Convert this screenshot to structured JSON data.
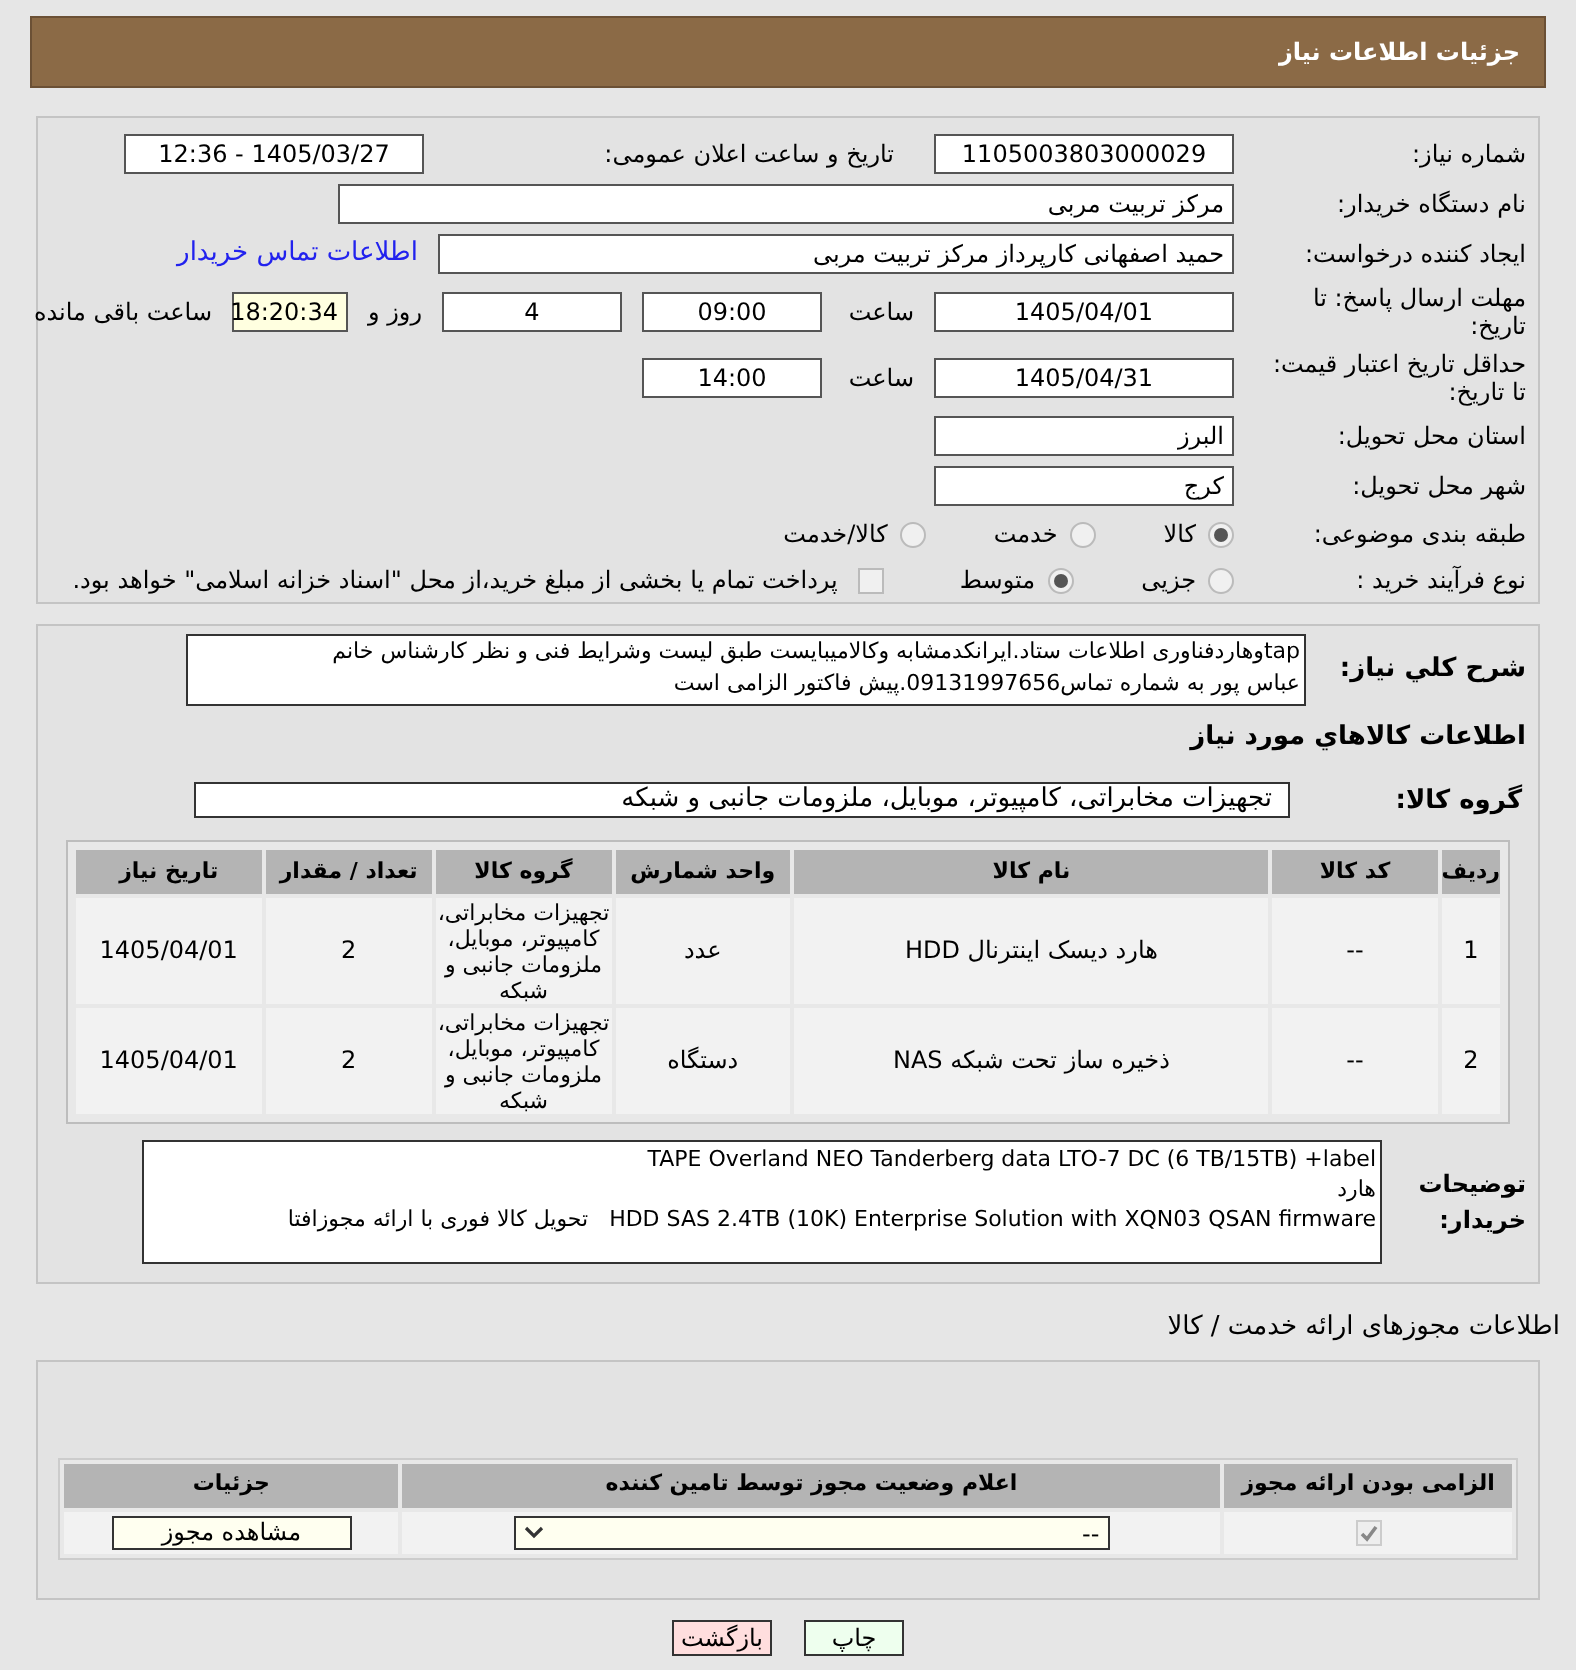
{
  "header": {
    "title": "جزئیات اطلاعات نیاز"
  },
  "need_number": {
    "label": "شماره نیاز:",
    "value": "1105003803000029"
  },
  "announce": {
    "label": "تاریخ و ساعت اعلان عمومی:",
    "value": "1405/03/27 - 12:36"
  },
  "buyer_org": {
    "label": "نام دستگاه خریدار:",
    "value": "مرکز تربیت مربی"
  },
  "creator": {
    "label": "ایجاد کننده درخواست:",
    "value": "حمید اصفهانی کارپرداز مرکز تربیت مربی",
    "link": "اطلاعات تماس خریدار"
  },
  "deadline": {
    "label": "مهلت ارسال پاسخ: تا تاریخ:",
    "date": "1405/04/01",
    "time_label": "ساعت",
    "time": "09:00",
    "days": "4",
    "days_label": "روز و",
    "remaining": "18:20:34",
    "remaining_label": "ساعت باقی مانده"
  },
  "validity": {
    "label": "حداقل تاریخ اعتبار قیمت: تا تاریخ:",
    "date": "1405/04/31",
    "time_label": "ساعت",
    "time": "14:00"
  },
  "province": {
    "label": "استان محل تحویل:",
    "value": "البرز"
  },
  "city": {
    "label": "شهر محل تحویل:",
    "value": "کرج"
  },
  "category": {
    "label": "طبقه بندی موضوعی:",
    "options": [
      {
        "label": "کالا",
        "selected": true
      },
      {
        "label": "خدمت",
        "selected": false
      },
      {
        "label": "کالا/خدمت",
        "selected": false
      }
    ]
  },
  "process": {
    "label": "نوع فرآیند خرید :",
    "options": [
      {
        "label": "جزیی",
        "selected": false
      },
      {
        "label": "متوسط",
        "selected": true
      }
    ],
    "payment": {
      "label": "پرداخت تمام یا بخشی از مبلغ خرید،از محل \"اسناد خزانه اسلامی\" خواهد بود.",
      "checked": false
    }
  },
  "description": {
    "label": "شرح کلي نیاز:",
    "lines": [
      "tapوهاردفناوری اطلاعات ستاد.ایرانکدمشابه وکالامیبایست طبق لیست وشرایط فنی و نظر کارشناس خانم",
      "عباس پور به شماره تماس09131997656.پیش فاکتور الزامی است"
    ]
  },
  "goods_title": "اطلاعات کالاهاي مورد نیاز",
  "group": {
    "label": "گروه کالا:",
    "value": "تجهیزات مخابراتی، کامپیوتر، موبایل، ملزومات جانبی و شبکه"
  },
  "items": {
    "columns": [
      "ردیف",
      "کد کالا",
      "نام کالا",
      "واحد شمارش",
      "گروه کالا",
      "تعداد / مقدار",
      "تاریخ نیاز"
    ],
    "rows": [
      [
        "1",
        "--",
        "هارد دیسک اینترنال HDD",
        "عدد",
        "تجهیزات مخابراتی، کامپیوتر، موبایل، ملزومات جانبی و شبکه",
        "2",
        "1405/04/01"
      ],
      [
        "2",
        "--",
        "ذخیره ساز تحت شبکه NAS",
        "دستگاه",
        "تجهیزات مخابراتی، کامپیوتر، موبایل، ملزومات جانبی و شبکه",
        "2",
        "1405/04/01"
      ]
    ]
  },
  "buyer_notes": {
    "label": "توضیحات خریدار:",
    "lines": [
      "TAPE Overland NEO Tanderberg data LTO-7 DC (6 TB/15TB) +label",
      "هارد",
      "HDD SAS 2.4TB (10K) Enterprise Solution with XQN03 QSAN firmware   تحویل کالا فوری با ارائه مجوزافتا"
    ]
  },
  "permits": {
    "title": "اطلاعات مجوزهای ارائه خدمت / کالا",
    "columns": [
      "الزامی بودن ارائه مجوز",
      "اعلام وضعیت مجوز توسط تامین کننده",
      "جزئیات"
    ],
    "rows": [
      {
        "required": true,
        "status": "--",
        "action": "مشاهده مجوز"
      }
    ]
  },
  "buttons": [
    {
      "label": "چاپ",
      "kind": "print"
    },
    {
      "label": "بازگشت",
      "kind": "back"
    }
  ]
}
